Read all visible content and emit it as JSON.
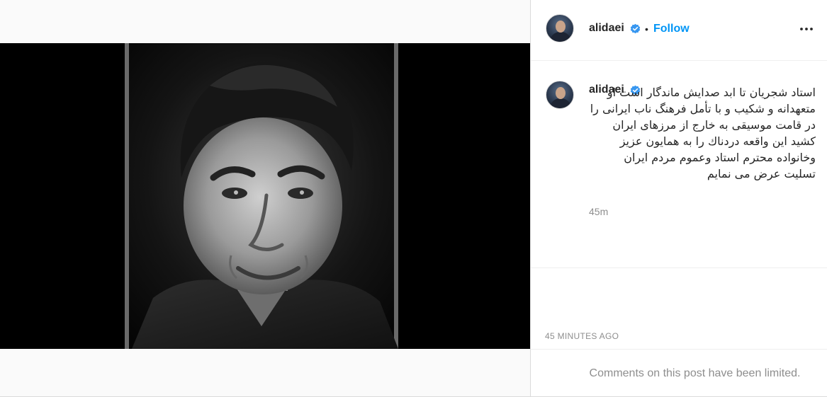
{
  "header": {
    "username": "alidaei",
    "separator": "•",
    "follow_label": "Follow"
  },
  "caption": {
    "username": "alidaei",
    "text": "استاد شجریان تا ابد صدایش ماندگار است او متعهدانه و شکیب و با تأمل فرهنگ ناب ایرانی را در قامت موسیقی به خارج از مرزهای ایران کشید این واقعه دردناك را به همایون عزیز وخانواده محترم استاد وعموم مردم ایران تسلیت عرض می نمایم",
    "time": "45m"
  },
  "post": {
    "posted_ago": "45 MINUTES AGO",
    "comments_notice": "Comments on this post have been limited."
  },
  "media": {
    "type": "video",
    "muted": true,
    "mute_icon": "speaker-muted-icon"
  },
  "icons": {
    "verified": "verified-badge-icon",
    "more": "more-options-icon"
  },
  "colors": {
    "follow": "#0095f6",
    "verified": "#3897f0",
    "muted_text": "#8e8e8e"
  }
}
